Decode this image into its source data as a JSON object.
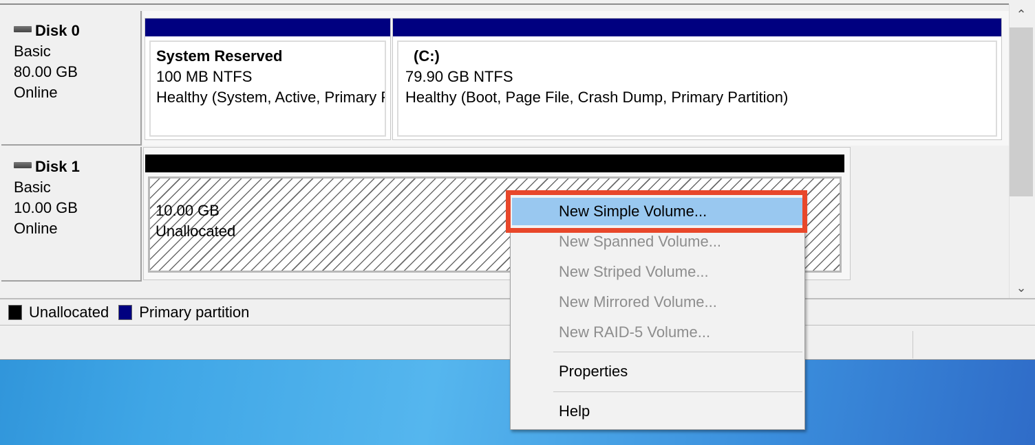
{
  "disks": [
    {
      "name": "Disk 0",
      "type": "Basic",
      "size": "80.00 GB",
      "status": "Online",
      "partitions": [
        {
          "title": "System Reserved",
          "fs": "100 MB NTFS",
          "status": "Healthy (System, Active, Primary Partition)"
        },
        {
          "title": "(C:)",
          "fs": "79.90 GB NTFS",
          "status": "Healthy (Boot, Page File, Crash Dump, Primary Partition)"
        }
      ]
    },
    {
      "name": "Disk 1",
      "type": "Basic",
      "size": "10.00 GB",
      "status": "Online",
      "partitions": [
        {
          "size": "10.00 GB",
          "status": "Unallocated"
        }
      ]
    }
  ],
  "legend": [
    {
      "label": "Unallocated",
      "color": "#000000"
    },
    {
      "label": "Primary partition",
      "color": "#000080"
    }
  ],
  "context_menu": {
    "items": [
      {
        "label": "New Simple Volume...",
        "enabled": true,
        "selected": true
      },
      {
        "label": "New Spanned Volume...",
        "enabled": false
      },
      {
        "label": "New Striped Volume...",
        "enabled": false
      },
      {
        "label": "New Mirrored Volume...",
        "enabled": false
      },
      {
        "label": "New RAID-5 Volume...",
        "enabled": false
      },
      {
        "label": "Properties",
        "enabled": true
      },
      {
        "label": "Help",
        "enabled": true
      }
    ]
  },
  "colors": {
    "primary_partition_bar": "#000080",
    "unallocated_bar": "#000000",
    "menu_selection": "#99c8f0",
    "annotation_box": "#e8472a"
  }
}
